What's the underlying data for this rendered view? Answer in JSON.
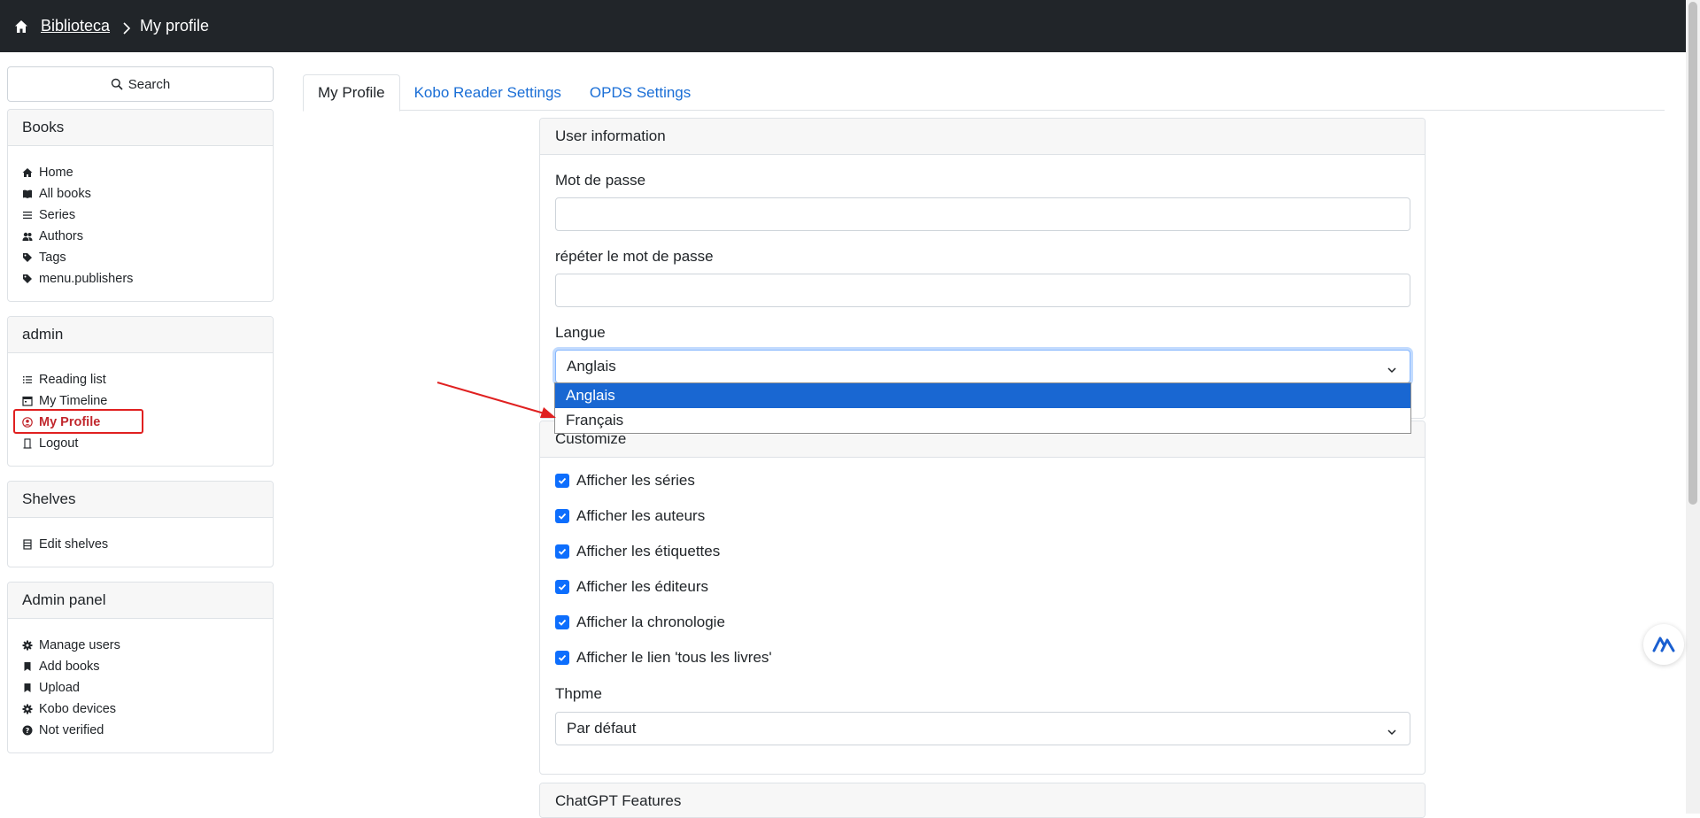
{
  "header": {
    "home_icon": "home-icon",
    "breadcrumb_root": "Biblioteca",
    "breadcrumb_current": "My profile"
  },
  "sidebar": {
    "search_label": "Search",
    "books": {
      "title": "Books",
      "items": [
        {
          "label": "Home",
          "icon": "home-icon"
        },
        {
          "label": "All books",
          "icon": "book-icon"
        },
        {
          "label": "Series",
          "icon": "list-icon"
        },
        {
          "label": "Authors",
          "icon": "users-icon"
        },
        {
          "label": "Tags",
          "icon": "tag-icon"
        },
        {
          "label": "menu.publishers",
          "icon": "tag-icon"
        }
      ]
    },
    "admin": {
      "title": "admin",
      "items": [
        {
          "label": "Reading list",
          "icon": "list-icon"
        },
        {
          "label": "My Timeline",
          "icon": "calendar-icon"
        },
        {
          "label": "My Profile",
          "icon": "user-circle-icon"
        },
        {
          "label": "Logout",
          "icon": "door-icon"
        }
      ]
    },
    "shelves": {
      "title": "Shelves",
      "items": [
        {
          "label": "Edit shelves",
          "icon": "shelf-icon"
        }
      ]
    },
    "admin_panel": {
      "title": "Admin panel",
      "items": [
        {
          "label": "Manage users",
          "icon": "gear-icon"
        },
        {
          "label": "Add books",
          "icon": "bookmark-icon"
        },
        {
          "label": "Upload",
          "icon": "bookmark-icon"
        },
        {
          "label": "Kobo devices",
          "icon": "gear-icon"
        },
        {
          "label": "Not verified",
          "icon": "question-circle-icon"
        }
      ]
    }
  },
  "tabs": [
    {
      "label": "My Profile",
      "active": true
    },
    {
      "label": "Kobo Reader Settings",
      "active": false
    },
    {
      "label": "OPDS Settings",
      "active": false
    }
  ],
  "user_info": {
    "title": "User information",
    "password_label": "Mot de passe",
    "password_value": "",
    "repeat_password_label": "répéter le mot de passe",
    "repeat_password_value": "",
    "language_label": "Langue",
    "language_selected": "Anglais",
    "language_options": [
      "Anglais",
      "Français"
    ]
  },
  "customize": {
    "title": "Customize",
    "checkboxes": [
      {
        "label": "Afficher les séries",
        "checked": true
      },
      {
        "label": "Afficher les auteurs",
        "checked": true
      },
      {
        "label": "Afficher les étiquettes",
        "checked": true
      },
      {
        "label": "Afficher les éditeurs",
        "checked": true
      },
      {
        "label": "Afficher la chronologie",
        "checked": true
      },
      {
        "label": "Afficher le lien 'tous les livres'",
        "checked": true
      }
    ],
    "theme_label": "Thpme",
    "theme_selected": "Par défaut"
  },
  "chatgpt": {
    "title": "ChatGPT Features"
  },
  "colors": {
    "topbar": "#212529",
    "link": "#1a6ed6",
    "checkbox": "#0d6efd",
    "dropdown_selected": "#1967d2",
    "annotation": "#e02020"
  }
}
